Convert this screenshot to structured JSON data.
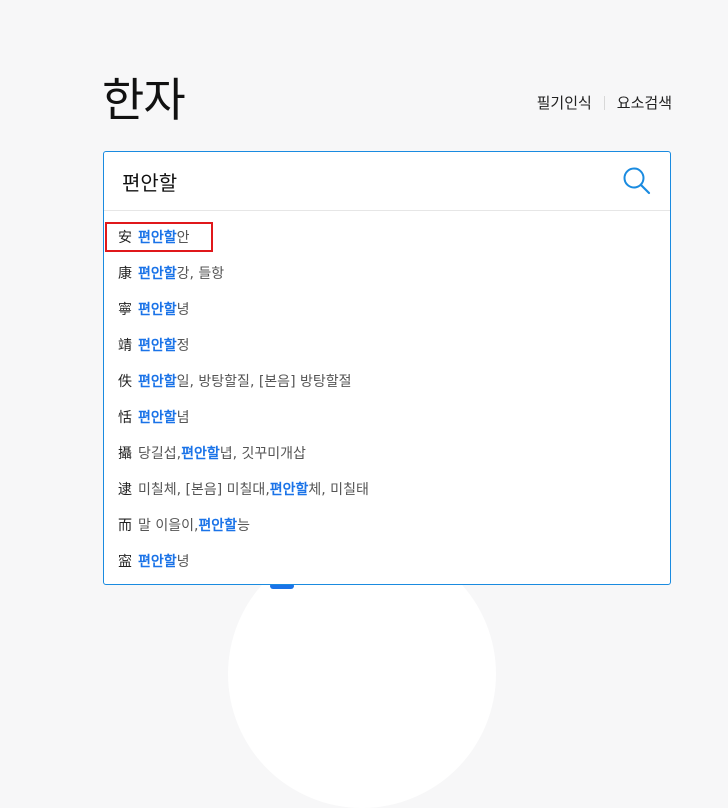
{
  "page": {
    "title": "한자"
  },
  "header_links": [
    {
      "label": "필기인식"
    },
    {
      "label": "요소검색"
    }
  ],
  "search": {
    "value": "편안할",
    "placeholder": ""
  },
  "colors": {
    "accent": "#1a73e8",
    "border": "#1a8be0",
    "highlight": "#e0181b"
  },
  "suggestions": [
    {
      "hanja": "安",
      "pre": "",
      "hl": "편안할",
      "post": "안",
      "boxed": true
    },
    {
      "hanja": "康",
      "pre": "",
      "hl": "편안할",
      "post": "강, 들항"
    },
    {
      "hanja": "寧",
      "pre": "",
      "hl": "편안할",
      "post": "녕"
    },
    {
      "hanja": "靖",
      "pre": "",
      "hl": "편안할",
      "post": "정"
    },
    {
      "hanja": "佚",
      "pre": "",
      "hl": "편안할",
      "post": "일, 방탕할질, [본음] 방탕할절"
    },
    {
      "hanja": "恬",
      "pre": "",
      "hl": "편안할",
      "post": "념"
    },
    {
      "hanja": "攝",
      "pre": "당길섭, ",
      "hl": "편안할",
      "post": "녑, 깃꾸미개삽"
    },
    {
      "hanja": "逮",
      "pre": "미칠체, [본음] 미칠대, ",
      "hl": "편안할",
      "post": "체, 미칠태"
    },
    {
      "hanja": "而",
      "pre": "말 이을이, ",
      "hl": "편안할",
      "post": "능"
    },
    {
      "hanja": "寍",
      "pre": "",
      "hl": "편안할",
      "post": "녕"
    }
  ]
}
